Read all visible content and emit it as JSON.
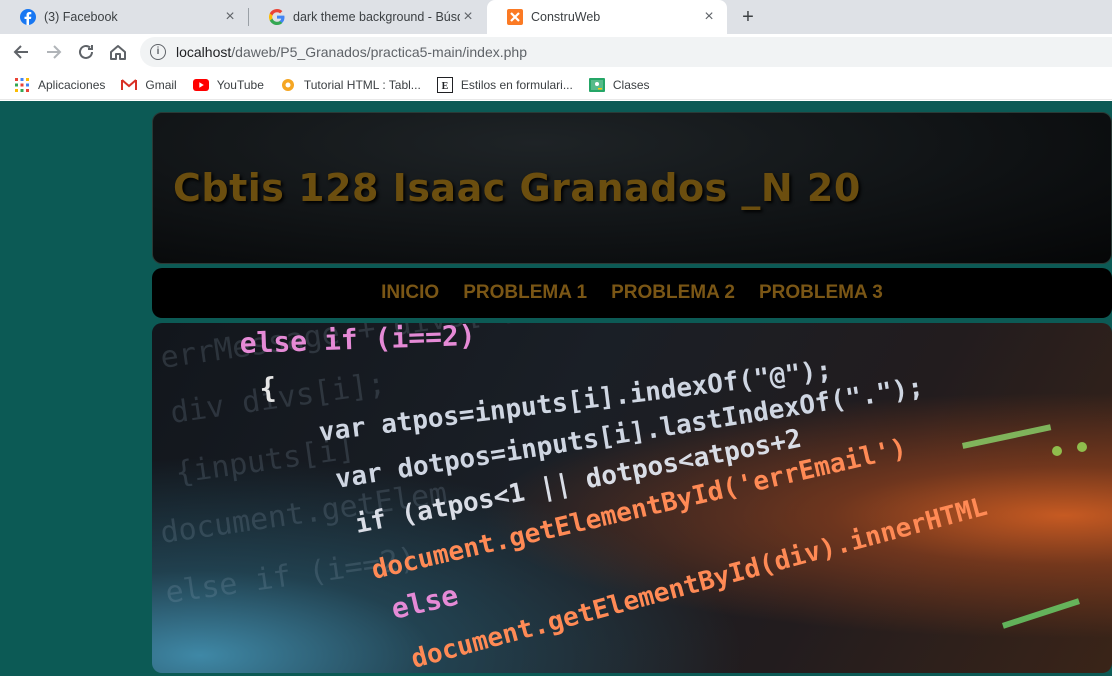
{
  "browser": {
    "tabs": [
      {
        "title": "(3) Facebook",
        "icon": "facebook-icon"
      },
      {
        "title": "dark theme background - Búsqu",
        "icon": "google-icon"
      },
      {
        "title": "ConstruWeb",
        "icon": "xampp-icon"
      }
    ],
    "url_host": "localhost",
    "url_path": "/daweb/P5_Granados/practica5-main/index.php",
    "bookmarks": [
      {
        "label": "Aplicaciones",
        "icon": "apps-grid-icon"
      },
      {
        "label": "Gmail",
        "icon": "gmail-icon"
      },
      {
        "label": "YouTube",
        "icon": "youtube-icon"
      },
      {
        "label": "Tutorial HTML : Tabl...",
        "icon": "tutorial-icon"
      },
      {
        "label": "Estilos en formulari...",
        "icon": "estilos-icon"
      },
      {
        "label": "Clases",
        "icon": "classroom-icon"
      }
    ]
  },
  "page": {
    "title": "Cbtis 128 Isaac Granados _N 20",
    "nav": [
      "INICIO",
      "PROBLEMA 1",
      "PROBLEMA 2",
      "PROBLEMA 3"
    ],
    "hero_code": [
      "else if (i==2)",
      "{",
      "var atpos=inputs[i].indexOf(\"@\");",
      "var dotpos=inputs[i].lastIndexOf(\".\");",
      "if (atpos<1 || dotpos<atpos+2",
      "document.getElementById('errEmail')",
      "else",
      "document.getElementById(div).innerHTML"
    ]
  },
  "colors": {
    "page_bg": "#0c5a55",
    "title": "#6b4e0f",
    "nav_link": "#7a5615"
  }
}
